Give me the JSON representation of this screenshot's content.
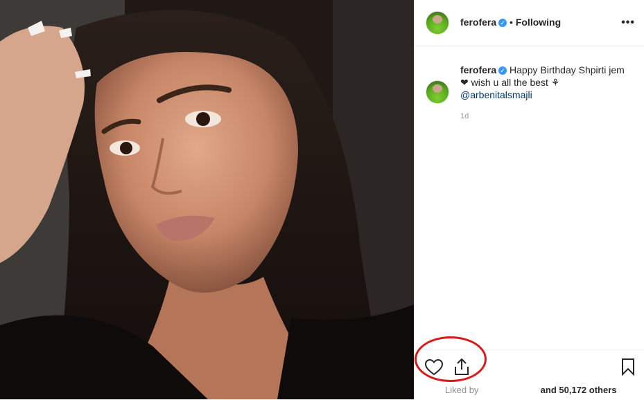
{
  "post": {
    "username": "ferofera",
    "verified_icon": "verified-badge-icon",
    "follow_separator": "•",
    "follow_status": "Following",
    "more_icon": "more-options-icon",
    "caption": {
      "username": "ferofera",
      "text": "Happy Birthday Shpirti jem",
      "line2": "wish u all the best",
      "mention": "@arbenitalsmajli",
      "emoji_heart": "❤",
      "emoji_flower": "⚘"
    },
    "time": "1d",
    "likes": {
      "prefix": "Liked by",
      "suffix": "and 50,172 others"
    }
  },
  "colors": {
    "link": "#003569",
    "verified": "#3897f0",
    "highlight_circle": "#d71a1a"
  },
  "icons": [
    "heart-icon",
    "share-icon",
    "bookmark-icon"
  ]
}
